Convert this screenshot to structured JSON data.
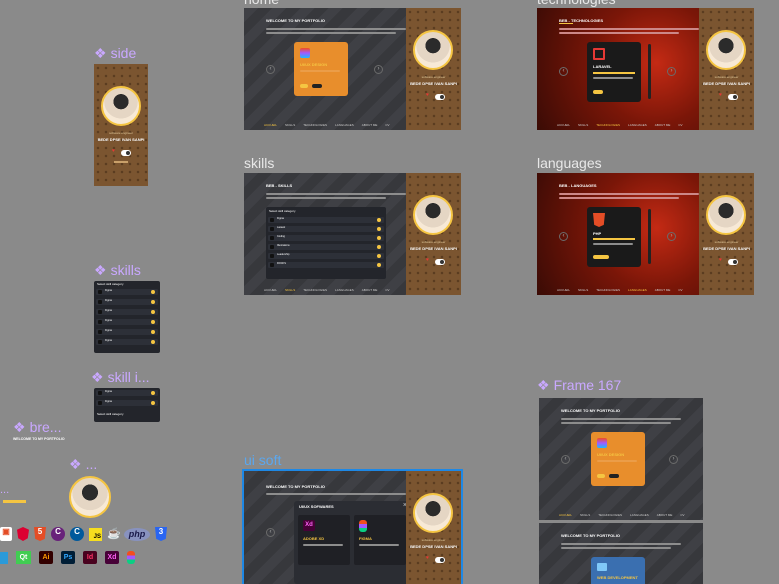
{
  "canvas": {
    "background": "#8a8a8a",
    "accent": "#f5c542",
    "selection": "#1e88e5",
    "component_color": "#c9a8ff"
  },
  "frame_labels": {
    "home": "home",
    "technologies": "technologies",
    "skills": "skills",
    "languages": "languages",
    "ui_soft": "ui soft"
  },
  "component_labels": {
    "side": "side",
    "skills": "skills",
    "skill_item": "skill i...",
    "breadcrumb": "bre...",
    "avatar_comp": "...",
    "frame167": "Frame 167",
    "left_dash": "..."
  },
  "profile": {
    "name": "BEDE DPSE IVAN SANPI",
    "subtitle": "software engineer"
  },
  "home": {
    "title": "WELCOME TO MY PORTFOLIO",
    "card_title": "UI/UX DESIGN"
  },
  "technologies": {
    "title": "BEB - TECHNOLOGIES",
    "card_title": "LARAVEL"
  },
  "skills": {
    "title": "BEB - SKILLS",
    "list_header": "Select skill category",
    "items": [
      "Figma",
      "Laravel",
      "Coding",
      "Illustrations",
      "Leadership",
      "DOCKS"
    ]
  },
  "languages": {
    "title": "BEB - LANGUAGES",
    "card_title": "PHP"
  },
  "ui_soft": {
    "title": "WELCOME TO MY PORTFOLIO",
    "modal_title": "UI/UX SOFWARES",
    "close": "×",
    "apps": [
      {
        "name": "ADOBE XD",
        "icon": "Xd"
      },
      {
        "name": "FIGMA",
        "icon": "F"
      }
    ]
  },
  "frame167": {
    "title": "WELCOME TO MY PORTFOLIO",
    "card_title": "UI/UX DESIGN",
    "title2": "WELCOME TO MY PORTFOLIO",
    "card_title2": "WEB DEVELOPMENT"
  },
  "breadcrumb_text": "WELCOME TO MY PORTFOLIO",
  "nav": [
    "ACCUEIL",
    "SKILLS",
    "TECHNOLOGIES",
    "LANGUAGES",
    "ABOUT ME",
    "CV"
  ],
  "icon_row1": [
    "html",
    "angular",
    "html5",
    "c#",
    "c++",
    "js",
    "java",
    "php",
    "css3"
  ],
  "icon_row2": [
    "cmd",
    "qt",
    "Ai",
    "Ps",
    "Id",
    "Xd",
    "figma"
  ],
  "icon_row1_text": {
    "js": "JS",
    "php": "php"
  },
  "icon_row2_text": {
    "qt": "Qt",
    "Ai": "Ai",
    "Ps": "Ps",
    "Id": "Id",
    "Xd": "Xd"
  }
}
